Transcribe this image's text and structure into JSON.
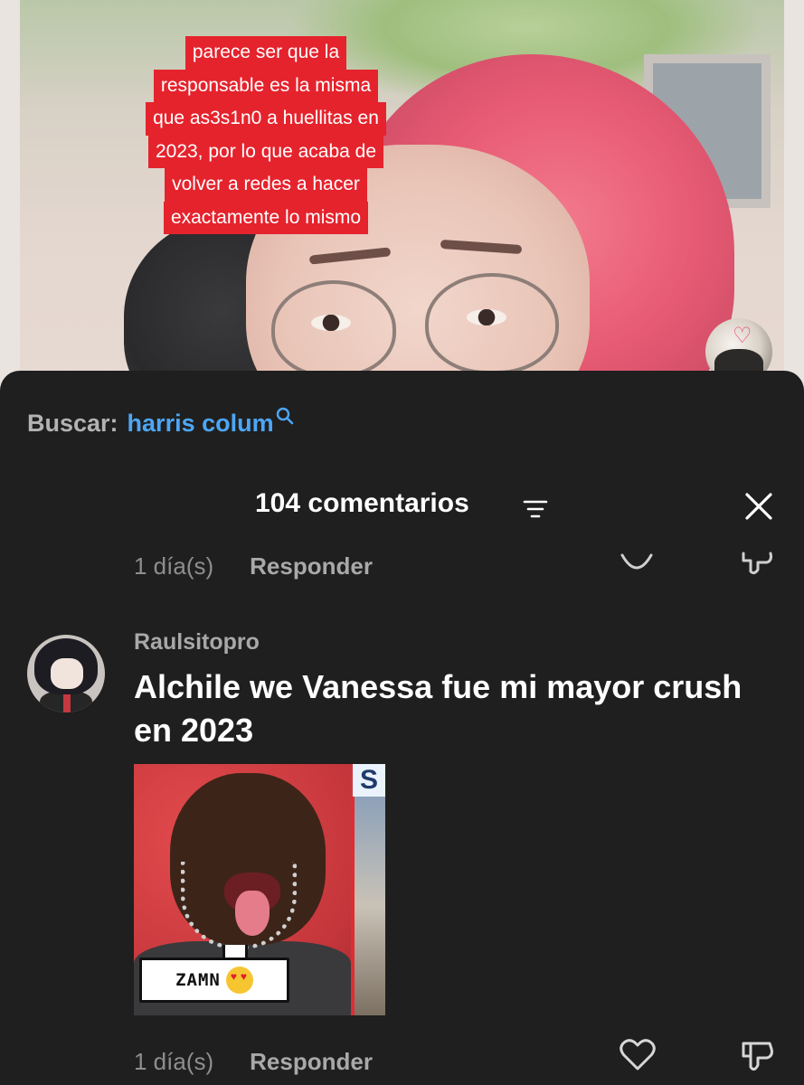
{
  "video": {
    "caption_lines": [
      "parece ser que la",
      "responsable es la misma",
      "que as3s1n0 a huellitas en",
      "2023, por lo que acaba de",
      "volver a redes a hacer",
      "exactamente lo mismo"
    ]
  },
  "search": {
    "label": "Buscar:",
    "query": "harris colum",
    "icon": "search-icon"
  },
  "comments_header": {
    "title": "104 comentarios",
    "sort_icon": "sort-icon",
    "close_icon": "close-icon"
  },
  "previous_comment": {
    "time": "1 día(s)",
    "reply_label": "Responder"
  },
  "comment": {
    "username": "Raulsitopro",
    "text": "Alchile we Vanessa fue mi mayor crush en 2023",
    "sticker": {
      "bubble_text": "ZAMN",
      "panel_label": "S"
    },
    "time": "1 día(s)",
    "reply_label": "Responder"
  },
  "colors": {
    "sheet_bg": "#1f1f1f",
    "caption_bg": "#e5232d",
    "search_query": "#4da6f5",
    "muted_text": "#8e8e8e"
  }
}
